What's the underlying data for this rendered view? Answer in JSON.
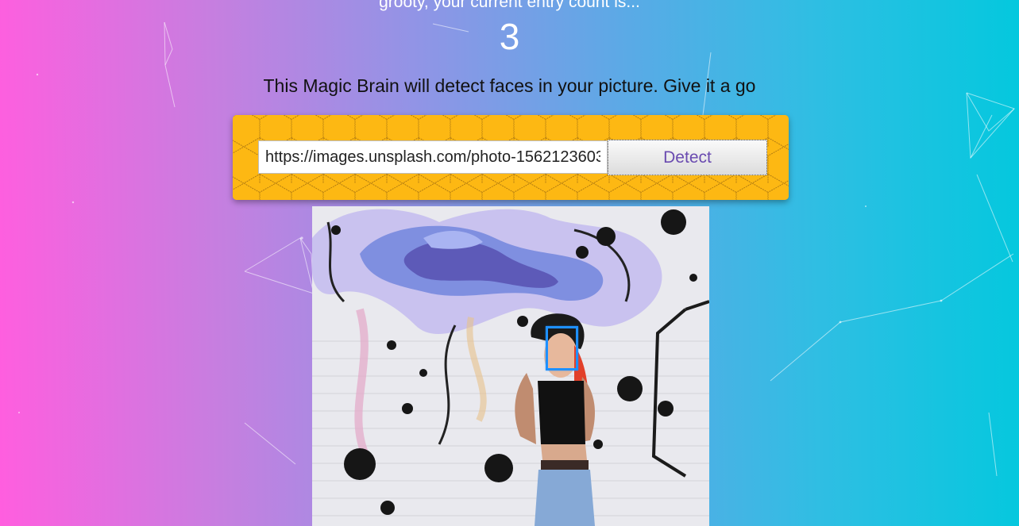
{
  "rank": {
    "text": "grooty, your current entry count is...",
    "count": "3"
  },
  "instructions": "This Magic Brain will detect faces in your picture. Give it a go",
  "form": {
    "url_value": "https://images.unsplash.com/photo-1562123603",
    "detect_label": "Detect"
  },
  "colors": {
    "gradient_left": "#ff5edf",
    "gradient_right": "#04c8de",
    "panel_yellow": "#fdb813",
    "button_text": "#6a4bb0",
    "face_box": "#1e90ff"
  },
  "image": {
    "description_icon": "face-photo",
    "faces_detected": 1
  }
}
